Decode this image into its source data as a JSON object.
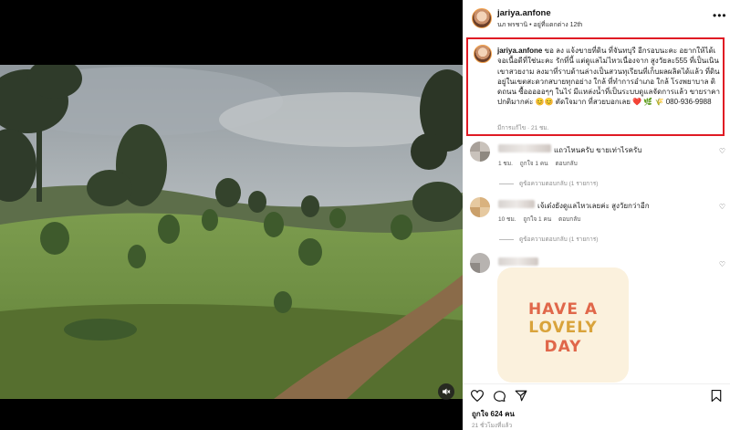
{
  "post": {
    "username": "jariya.anfone",
    "location": "นภ พรชานิ • อยู่ที่แดกต่าง 12th",
    "caption_username": "jariya.anfone",
    "caption_text": "ขอ ลง แจ้งขายที่ดิน ที่จันทบุรี อีกรอบนะคะ อยากให้ได้เจอเนื้อดีที่ใช่นะคะ รักที่นี้ แต่ดูแลไม่ไหวเนื่องจาก สูงวัยละ555 ที่เป็นเนินเขาสวยงาม ลงมาที่ราบด้านล่างเป็นสวนทุเรียนที่เก็บผลผลิตได้แล้ว ที่ดินอยู่ในเขตสะดวกสบายทุกอย่าง ใกล้ ที่ทำการอำเภอ ใกล้ โรงพยาบาล ติดถนน ซื้อออออๆๆ ในไร่ มีแหล่งน้ำที่เป็นระบบดูแลจัดการแล้ว ขายราคาปกติมากค่ะ 😊😊 ตัดใจมาก ที่สวยบอกเลย ❤️ 🌿 🌾 080-936-9988",
    "caption_meta": "มีการแก้ไข · 21 ชม."
  },
  "comments": [
    {
      "text": "แถวไหนครับ ขายเท่าไรครับ",
      "time": "1 ชม.",
      "likes": "ถูกใจ 1 คน",
      "reply": "ตอบกลับ",
      "view_replies": "ดูข้อความตอบกลับ (1 รายการ)"
    },
    {
      "text": "เจ้เด๋งยังดูแลไหวเลยค่ะ สูงวัยกว่าอีก",
      "time": "10 ชม.",
      "likes": "ถูกใจ 1 คน",
      "reply": "ตอบกลับ",
      "view_replies": "ดูข้อความตอบกลับ (1 รายการ)"
    }
  ],
  "sticker": {
    "line1": "HAVE A",
    "line2": "LOVELY",
    "line3": "DAY"
  },
  "footer": {
    "likes": "ถูกใจ 624 คน",
    "time": "21 ชั่วโมงที่แล้ว"
  },
  "icons": {
    "more": "more-dots-icon",
    "heart": "heart-icon",
    "comment": "comment-icon",
    "share": "share-icon",
    "save": "bookmark-icon",
    "mute": "muted-speaker-icon"
  },
  "colors": {
    "highlight_border": "#e01b24",
    "avatar_ring": "#f3a24b",
    "sticker_bg": "#fbf1dd"
  }
}
